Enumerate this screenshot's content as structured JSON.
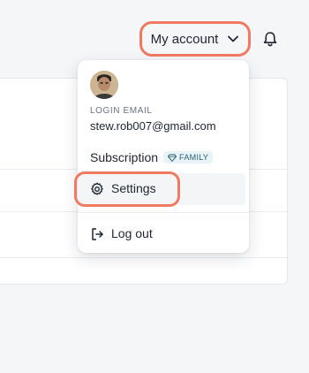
{
  "header": {
    "account_label": "My account",
    "icons": {
      "chevron": "chevron-down-icon",
      "bell": "bell-icon"
    }
  },
  "dropdown": {
    "login_email_label": "LOGIN EMAIL",
    "email": "stew.rob007@gmail.com",
    "subscription_label": "Subscription",
    "subscription_badge": "FAMILY",
    "settings_label": "Settings",
    "logout_label": "Log out"
  },
  "colors": {
    "highlight": "#f07a60",
    "badge_bg": "#e7f3f6",
    "badge_text": "#2a6173"
  }
}
